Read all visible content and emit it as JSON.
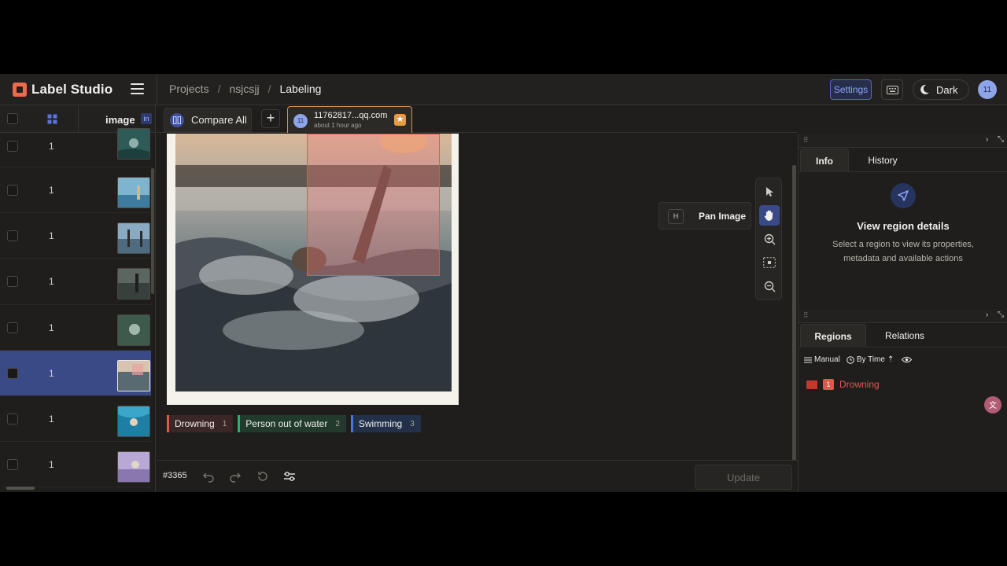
{
  "app": {
    "name": "Label Studio"
  },
  "breadcrumb": {
    "projects": "Projects",
    "project": "nsjcsjj",
    "current": "Labeling",
    "sep": "/"
  },
  "header": {
    "settings": "Settings",
    "theme": "Dark",
    "user_initials": "11"
  },
  "table": {
    "col_name": "image",
    "col_badge": "in",
    "rows": [
      {
        "count": "1",
        "selected": false
      },
      {
        "count": "1",
        "selected": false
      },
      {
        "count": "1",
        "selected": false
      },
      {
        "count": "1",
        "selected": false
      },
      {
        "count": "1",
        "selected": false
      },
      {
        "count": "1",
        "selected": true
      },
      {
        "count": "1",
        "selected": false
      },
      {
        "count": "1",
        "selected": false
      }
    ]
  },
  "tabs": {
    "compare": "Compare All",
    "add": "+",
    "annotation": {
      "avatar": "11",
      "user": "11762817...qq.com",
      "time": "about 1 hour ago"
    }
  },
  "canvas": {
    "tooltip": {
      "key": "H",
      "text": "Pan Image"
    },
    "labels": [
      {
        "name": "Drowning",
        "hotkey": "1"
      },
      {
        "name": "Person out of water",
        "hotkey": "2"
      },
      {
        "name": "Swimming",
        "hotkey": "3"
      }
    ]
  },
  "bottom": {
    "task_id": "#3365",
    "update": "Update"
  },
  "right": {
    "info_tab": "Info",
    "history_tab": "History",
    "info_title": "View region details",
    "info_desc": "Select a region to view its properties, metadata and available actions",
    "regions_tab": "Regions",
    "relations_tab": "Relations",
    "filter_manual": "Manual",
    "filter_sort": "By Time",
    "regions": [
      {
        "num": "1",
        "label": "Drowning"
      }
    ]
  },
  "colors": {
    "accent": "#3a4a86",
    "drowning": "#e2574c",
    "person": "#2fae6a",
    "swimming": "#3e7be0"
  }
}
